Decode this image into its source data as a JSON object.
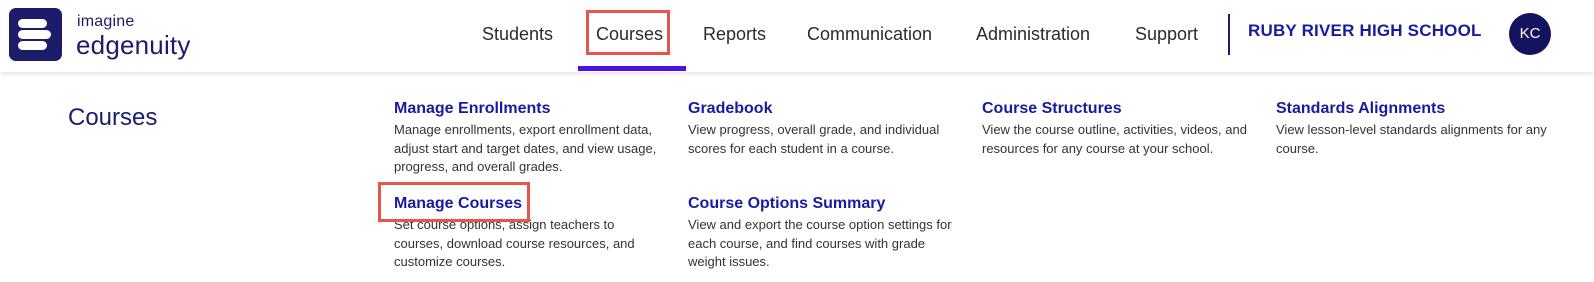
{
  "brand": {
    "line1": "imagine",
    "line2": "edgenuity",
    "color": "#1c1c6b"
  },
  "nav": {
    "items": [
      {
        "label": "Students"
      },
      {
        "label": "Courses"
      },
      {
        "label": "Reports"
      },
      {
        "label": "Communication"
      },
      {
        "label": "Administration"
      },
      {
        "label": "Support"
      }
    ],
    "active_index": 1
  },
  "school": "RUBY RIVER HIGH SCHOOL",
  "user": {
    "initials": "KC"
  },
  "menu": {
    "title": "Courses",
    "columns": [
      [
        {
          "title": "Manage Enrollments",
          "desc": "Manage enrollments, export enrollment data, adjust start and target dates, and view usage, progress, and overall grades."
        },
        {
          "title": "Manage Courses",
          "desc": "Set course options, assign teachers to courses, download course resources, and customize courses."
        }
      ],
      [
        {
          "title": "Gradebook",
          "desc": "View progress, overall grade, and individual scores for each student in a course."
        },
        {
          "title": "Course Options Summary",
          "desc": "View and export the course option settings for each course, and find courses with grade weight issues."
        }
      ],
      [
        {
          "title": "Course Structures",
          "desc": "View the course outline, activities, videos, and resources for any course at your school."
        }
      ],
      [
        {
          "title": "Standards Alignments",
          "desc": "View lesson-level standards alignments for any course."
        }
      ]
    ]
  },
  "colors": {
    "accent": "#4a12e6",
    "highlight": "#e8564a",
    "link": "#1a1aa0"
  },
  "icons": [
    "edgenuity-logo-icon"
  ]
}
